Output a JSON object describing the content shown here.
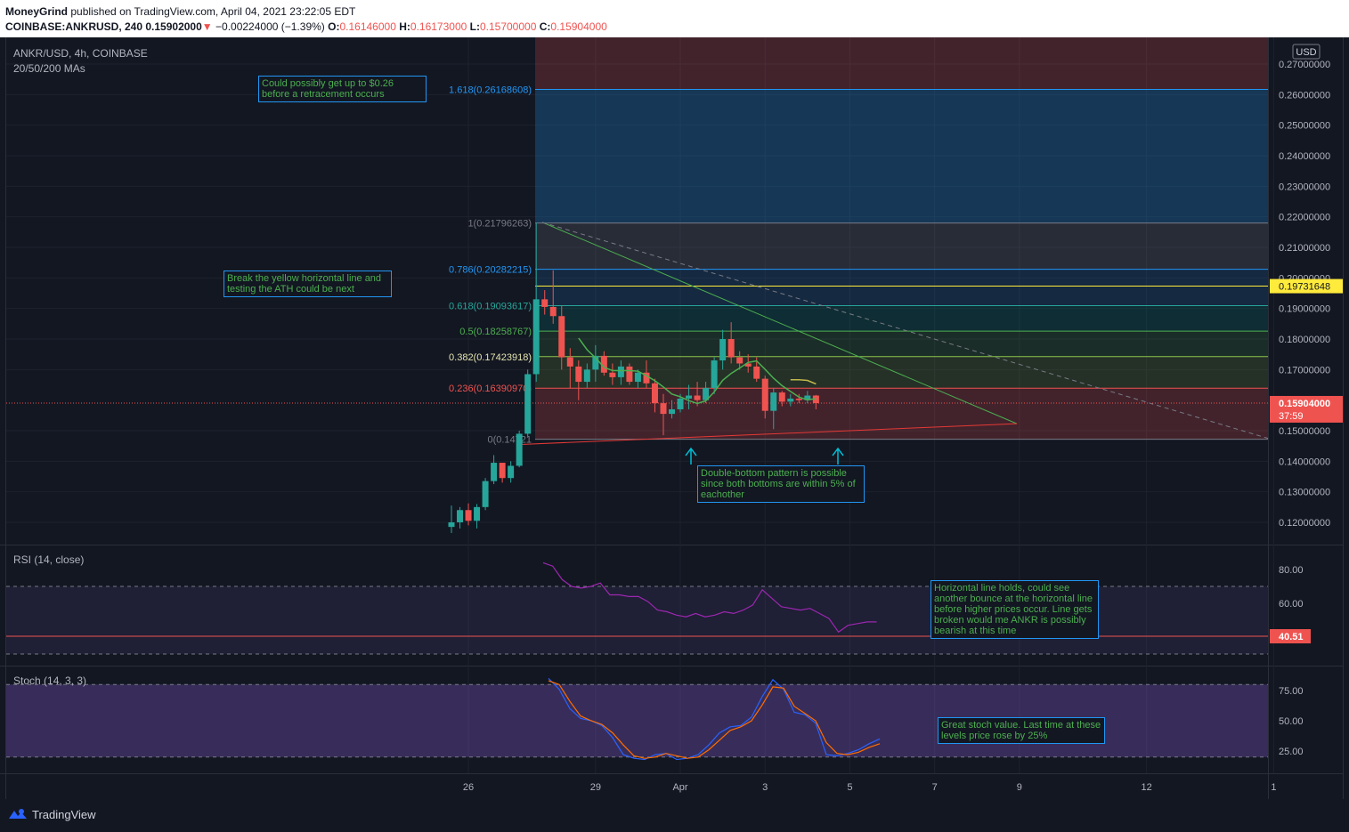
{
  "header": {
    "author": "MoneyGrind",
    "published_text": "published on TradingView.com, April 04, 2021 23:22:05 EDT",
    "symbol_line": "COINBASE:ANKRUSD, 240",
    "last": "0.15902000",
    "change": "−0.00224000 (−1.39%)",
    "o_label": "O:",
    "o_value": "0.16146000",
    "h_label": "H:",
    "h_value": "0.16173000",
    "l_label": "L:",
    "l_value": "0.15700000",
    "c_label": "C:",
    "c_value": "0.15904000"
  },
  "legend": {
    "symbol": "ANKR/USD, 4h, COINBASE",
    "mas": "20/50/200 MAs",
    "rsi": "RSI (14, close)",
    "stoch": "Stoch (14, 3, 3)"
  },
  "currency_badge": "USD",
  "notes": {
    "n1": "Could possibly get up to $0.26 before a retracement occurs",
    "n2": "Break the yellow horizontal line and testing the ATH could be next",
    "n3": "Double-bottom pattern is possible since both bottoms are within 5% of eachother",
    "n4": "Horizontal line holds, could see another bounce at the horizontal line before higher prices occur. Line gets broken would me ANKR is possibly bearish at this time",
    "n5": "Great stoch value. Last time at these levels price rose by 25%"
  },
  "footer": {
    "brand": "TradingView"
  },
  "colors": {
    "up": "#26a69a",
    "down": "#ef5350",
    "fib_blue": "#2196f3",
    "yellow": "#ffeb3b",
    "ma_green": "#4caf50",
    "ma_olive": "#c0b84a",
    "trend_green": "#4caf50",
    "support_red": "#e53935",
    "rsi": "#9c27b0",
    "stoch_k": "#2962ff",
    "stoch_d": "#ff6d00"
  },
  "chart_data": [
    {
      "type": "candlestick",
      "title": "ANKR/USD, 4h, COINBASE",
      "y_unit": "USD",
      "ylim": [
        0.115,
        0.2785
      ],
      "x_ticks": [
        "26",
        "29",
        "Apr",
        "3",
        "5",
        "7",
        "9",
        "12",
        "1"
      ],
      "y_ticks": [
        "0.27000000",
        "0.26000000",
        "0.25000000",
        "0.24000000",
        "0.23000000",
        "0.22000000",
        "0.21000000",
        "0.20000000",
        "0.19000000",
        "0.18000000",
        "0.17000000",
        "0.15000000",
        "0.14000000",
        "0.13000000",
        "0.12000000"
      ],
      "y_tick_values": [
        0.27,
        0.26,
        0.25,
        0.24,
        0.23,
        0.22,
        0.21,
        0.2,
        0.19,
        0.18,
        0.17,
        0.15,
        0.14,
        0.13,
        0.12
      ],
      "x_tick_bar_index": [
        2,
        17,
        27,
        37,
        47,
        57,
        67,
        82,
        97
      ],
      "candles": [
        [
          0.1185,
          0.1255,
          0.1165,
          0.12
        ],
        [
          0.12,
          0.125,
          0.118,
          0.124
        ],
        [
          0.124,
          0.1262,
          0.119,
          0.1205
        ],
        [
          0.1205,
          0.126,
          0.118,
          0.125
        ],
        [
          0.125,
          0.1345,
          0.124,
          0.1335
        ],
        [
          0.1335,
          0.142,
          0.1325,
          0.1395
        ],
        [
          0.1395,
          0.139,
          0.133,
          0.1345
        ],
        [
          0.1345,
          0.14,
          0.133,
          0.1385
        ],
        [
          0.1385,
          0.15,
          0.138,
          0.149
        ],
        [
          0.149,
          0.17,
          0.148,
          0.1685
        ],
        [
          0.1685,
          0.218,
          0.166,
          0.193
        ],
        [
          0.193,
          0.196,
          0.188,
          0.1905
        ],
        [
          0.1905,
          0.2025,
          0.185,
          0.1875
        ],
        [
          0.1875,
          0.191,
          0.17,
          0.174
        ],
        [
          0.174,
          0.177,
          0.164,
          0.171
        ],
        [
          0.171,
          0.173,
          0.16,
          0.166
        ],
        [
          0.166,
          0.172,
          0.164,
          0.17
        ],
        [
          0.17,
          0.178,
          0.166,
          0.1745
        ],
        [
          0.1745,
          0.176,
          0.168,
          0.169
        ],
        [
          0.169,
          0.172,
          0.165,
          0.1675
        ],
        [
          0.1675,
          0.173,
          0.165,
          0.171
        ],
        [
          0.171,
          0.172,
          0.165,
          0.166
        ],
        [
          0.166,
          0.17,
          0.164,
          0.169
        ],
        [
          0.169,
          0.173,
          0.164,
          0.1655
        ],
        [
          0.1655,
          0.167,
          0.156,
          0.159
        ],
        [
          0.159,
          0.162,
          0.1485,
          0.1555
        ],
        [
          0.1555,
          0.16,
          0.154,
          0.157
        ],
        [
          0.157,
          0.162,
          0.156,
          0.1605
        ],
        [
          0.1605,
          0.165,
          0.157,
          0.1615
        ],
        [
          0.1615,
          0.166,
          0.158,
          0.16
        ],
        [
          0.16,
          0.166,
          0.159,
          0.164
        ],
        [
          0.164,
          0.174,
          0.162,
          0.173
        ],
        [
          0.173,
          0.183,
          0.17,
          0.18
        ],
        [
          0.18,
          0.1855,
          0.172,
          0.174
        ],
        [
          0.174,
          0.176,
          0.17,
          0.172
        ],
        [
          0.172,
          0.175,
          0.169,
          0.171
        ],
        [
          0.171,
          0.174,
          0.166,
          0.167
        ],
        [
          0.167,
          0.168,
          0.154,
          0.1565
        ],
        [
          0.1565,
          0.164,
          0.1505,
          0.1625
        ],
        [
          0.1625,
          0.163,
          0.158,
          0.1595
        ],
        [
          0.1595,
          0.162,
          0.158,
          0.1605
        ],
        [
          0.1605,
          0.162,
          0.159,
          0.16
        ],
        [
          0.16,
          0.163,
          0.159,
          0.1615
        ],
        [
          0.1615,
          0.1617,
          0.157,
          0.159
        ]
      ],
      "fibonacci_levels": [
        {
          "label": "1.618(0.26168608)",
          "value": 0.26168608
        },
        {
          "label": "1(0.21796263)",
          "value": 0.21796263
        },
        {
          "label": "0.786(0.20282215)",
          "value": 0.20282215
        },
        {
          "label": "0.618(0.19093617)",
          "value": 0.19093617
        },
        {
          "label": "0.5(0.18258767)",
          "value": 0.18258767
        },
        {
          "label": "0.382(0.17423918)",
          "value": 0.17423918
        },
        {
          "label": "0.236(0.16390970)",
          "value": 0.1639097
        },
        {
          "label": "0(0.14721",
          "value": 0.14721
        }
      ],
      "horizontal_line": {
        "label": "0.19731648",
        "value": 0.19731648
      },
      "last_price": {
        "label": "0.15904000",
        "countdown": "37:59",
        "value": 0.15904
      }
    },
    {
      "type": "line",
      "title": "RSI (14, close)",
      "ylim": [
        28,
        92
      ],
      "y_ticks": [
        "80.00",
        "60.00"
      ],
      "y_tick_values": [
        80,
        60
      ],
      "bands": [
        70,
        30
      ],
      "current": {
        "label": "40.51",
        "value": 40.51
      },
      "series": [
        {
          "values": [
            84,
            82,
            74,
            70,
            69,
            70,
            72,
            65,
            65,
            64,
            64,
            61,
            56,
            55,
            53,
            52,
            54,
            52,
            53,
            55,
            54,
            56,
            59,
            68,
            63,
            58,
            57,
            56,
            57,
            54,
            51,
            43,
            47,
            48,
            49,
            49
          ]
        }
      ]
    },
    {
      "type": "line",
      "title": "Stoch (14, 3, 3)",
      "ylim": [
        5,
        93
      ],
      "y_ticks": [
        "75.00",
        "50.00",
        "25.00"
      ],
      "y_tick_values": [
        75,
        50,
        25
      ],
      "bands": [
        80,
        20
      ],
      "series": [
        {
          "values": [
            85,
            76,
            60,
            52,
            50,
            46,
            36,
            22,
            19,
            18,
            22,
            23,
            18,
            19,
            22,
            30,
            40,
            45,
            46,
            53,
            70,
            84,
            76,
            57,
            55,
            48,
            22,
            21,
            23,
            26,
            31,
            35
          ]
        },
        {
          "values": [
            83,
            80,
            66,
            54,
            50,
            47,
            40,
            30,
            21,
            19,
            20,
            23,
            21,
            19,
            20,
            26,
            34,
            42,
            45,
            50,
            63,
            78,
            77,
            62,
            56,
            50,
            32,
            23,
            22,
            24,
            28,
            31
          ]
        }
      ]
    }
  ]
}
